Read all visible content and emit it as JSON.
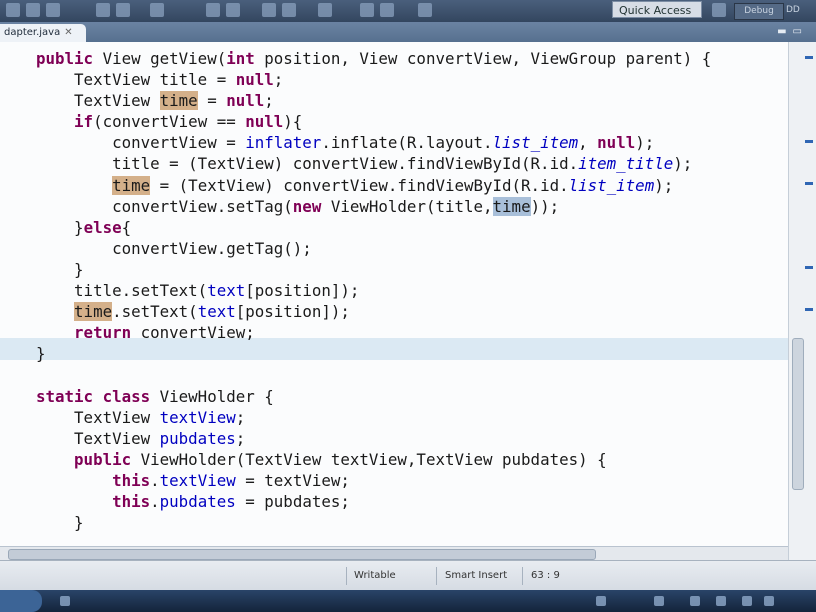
{
  "toolbar": {
    "quick_access": "Quick Access",
    "perspective": "Debug",
    "perspective2": "DD"
  },
  "tab": {
    "title": "dapter.java",
    "close": "✕"
  },
  "code": [
    [
      {
        "t": "public ",
        "c": "kw"
      },
      {
        "t": "View getView("
      },
      {
        "t": "int ",
        "c": "kw"
      },
      {
        "t": "position, View convertView, ViewGroup parent) {"
      }
    ],
    [
      {
        "t": "    TextView title = "
      },
      {
        "t": "null",
        "c": "kw"
      },
      {
        "t": ";"
      }
    ],
    [
      {
        "t": "    TextView "
      },
      {
        "t": "time",
        "c": "hl-occ"
      },
      {
        "t": " = "
      },
      {
        "t": "null",
        "c": "kw"
      },
      {
        "t": ";"
      }
    ],
    [
      {
        "t": "    "
      },
      {
        "t": "if",
        "c": "kw"
      },
      {
        "t": "(convertView == "
      },
      {
        "t": "null",
        "c": "kw"
      },
      {
        "t": "){"
      }
    ],
    [
      {
        "t": "        convertView = "
      },
      {
        "t": "inflater",
        "c": "fld"
      },
      {
        "t": ".inflate(R.layout."
      },
      {
        "t": "list_item",
        "c": "sfld"
      },
      {
        "t": ", "
      },
      {
        "t": "null",
        "c": "kw"
      },
      {
        "t": ");"
      }
    ],
    [
      {
        "t": "        title = (TextView) convertView.findViewById(R.id."
      },
      {
        "t": "item_title",
        "c": "sfld"
      },
      {
        "t": ");"
      }
    ],
    [
      {
        "t": "        "
      },
      {
        "t": "time",
        "c": "hl-occ"
      },
      {
        "t": " = (TextView) convertView.findViewById(R.id."
      },
      {
        "t": "list_item",
        "c": "sfld"
      },
      {
        "t": ");"
      }
    ],
    [
      {
        "t": "        convertView.setTag("
      },
      {
        "t": "new ",
        "c": "kw"
      },
      {
        "t": "ViewHolder(title,"
      },
      {
        "t": "time",
        "c": "hl-sel"
      },
      {
        "t": "));"
      }
    ],
    [
      {
        "t": "    }"
      },
      {
        "t": "else",
        "c": "kw"
      },
      {
        "t": "{"
      }
    ],
    [
      {
        "t": "        convertView.getTag();"
      }
    ],
    [
      {
        "t": "    }"
      }
    ],
    [
      {
        "t": "    title.setText("
      },
      {
        "t": "text",
        "c": "fld"
      },
      {
        "t": "[position]);"
      }
    ],
    [
      {
        "t": "    "
      },
      {
        "t": "time",
        "c": "hl-occ"
      },
      {
        "t": ".setText("
      },
      {
        "t": "text",
        "c": "fld"
      },
      {
        "t": "[position]);"
      }
    ],
    [
      {
        "t": "    "
      },
      {
        "t": "return ",
        "c": "kw"
      },
      {
        "t": "convertView;"
      }
    ],
    [
      {
        "t": "}"
      }
    ],
    [
      {
        "t": ""
      }
    ],
    [
      {
        "t": "static class ",
        "c": "kw"
      },
      {
        "t": "ViewHolder {"
      }
    ],
    [
      {
        "t": "    TextView "
      },
      {
        "t": "textView",
        "c": "fld"
      },
      {
        "t": ";"
      }
    ],
    [
      {
        "t": "    TextView "
      },
      {
        "t": "pubdates",
        "c": "fld"
      },
      {
        "t": ";"
      }
    ],
    [
      {
        "t": "    "
      },
      {
        "t": "public ",
        "c": "kw"
      },
      {
        "t": "ViewHolder(TextView textView,TextView pubdates) {"
      }
    ],
    [
      {
        "t": "        "
      },
      {
        "t": "this",
        "c": "kw"
      },
      {
        "t": "."
      },
      {
        "t": "textView",
        "c": "fld"
      },
      {
        "t": " = textView;"
      }
    ],
    [
      {
        "t": "        "
      },
      {
        "t": "this",
        "c": "kw"
      },
      {
        "t": "."
      },
      {
        "t": "pubdates",
        "c": "fld"
      },
      {
        "t": " = pubdates;"
      }
    ],
    [
      {
        "t": "    }"
      }
    ]
  ],
  "status": {
    "writable": "Writable",
    "insert_mode": "Smart Insert",
    "cursor_position": "63 : 9"
  },
  "colors": {
    "keyword": "#7f0055",
    "field": "#0000c0",
    "occurrence_highlight": "#d4b08a",
    "selection_highlight": "#a8bfd9",
    "current_line": "#dbe9f3"
  }
}
